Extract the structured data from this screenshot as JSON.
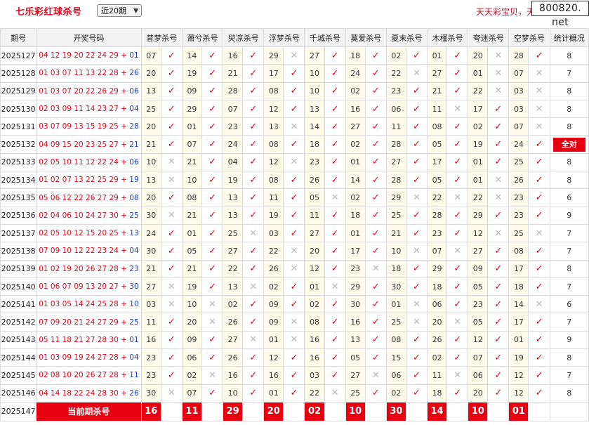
{
  "header": {
    "title": "七乐彩红球杀号",
    "period_select": "近20期",
    "slogan": "天天彩宝贝，天",
    "logo_text": "800820. net"
  },
  "table": {
    "columns": [
      "期号",
      "开奖号码",
      "昔梦杀号",
      "萧兮杀号",
      "臾凉杀号",
      "浮梦杀号",
      "千城杀号",
      "莫爱杀号",
      "夏末杀号",
      "木槿杀号",
      "夸迷杀号",
      "空梦杀号",
      "统计概况"
    ],
    "rows": [
      {
        "issue": "2025127",
        "reds": "04 12 19 20 22 24 29 +",
        "blue": "01",
        "kills": [
          {
            "n": "07",
            "m": "✓"
          },
          {
            "n": "14",
            "m": "✓"
          },
          {
            "n": "16",
            "m": "✓"
          },
          {
            "n": "29",
            "m": "✕"
          },
          {
            "n": "27",
            "m": "✓"
          },
          {
            "n": "18",
            "m": "✓"
          },
          {
            "n": "02",
            "m": "✓"
          },
          {
            "n": "01",
            "m": "✓"
          },
          {
            "n": "20",
            "m": "✕"
          },
          {
            "n": "28",
            "m": "✓"
          }
        ],
        "total": "8"
      },
      {
        "issue": "2025128",
        "reds": "01 03 07 11 13 22 28 +",
        "blue": "26",
        "kills": [
          {
            "n": "20",
            "m": "✓"
          },
          {
            "n": "19",
            "m": "✓"
          },
          {
            "n": "21",
            "m": "✓"
          },
          {
            "n": "17",
            "m": "✓"
          },
          {
            "n": "10",
            "m": "✓"
          },
          {
            "n": "24",
            "m": "✓"
          },
          {
            "n": "22",
            "m": "✕"
          },
          {
            "n": "27",
            "m": "✓"
          },
          {
            "n": "01",
            "m": "✕"
          },
          {
            "n": "07",
            "m": "✕"
          }
        ],
        "total": "7"
      },
      {
        "issue": "2025129",
        "reds": "01 03 07 20 22 26 29 +",
        "blue": "06",
        "kills": [
          {
            "n": "13",
            "m": "✓"
          },
          {
            "n": "09",
            "m": "✓"
          },
          {
            "n": "28",
            "m": "✓"
          },
          {
            "n": "08",
            "m": "✓"
          },
          {
            "n": "10",
            "m": "✓"
          },
          {
            "n": "02",
            "m": "✓"
          },
          {
            "n": "23",
            "m": "✓"
          },
          {
            "n": "21",
            "m": "✓"
          },
          {
            "n": "22",
            "m": "✕"
          },
          {
            "n": "03",
            "m": "✕"
          }
        ],
        "total": "8"
      },
      {
        "issue": "2025130",
        "reds": "02 03 09 11 14 23 27 +",
        "blue": "04",
        "kills": [
          {
            "n": "25",
            "m": "✓"
          },
          {
            "n": "29",
            "m": "✓"
          },
          {
            "n": "07",
            "m": "✓"
          },
          {
            "n": "12",
            "m": "✓"
          },
          {
            "n": "13",
            "m": "✓"
          },
          {
            "n": "16",
            "m": "✓"
          },
          {
            "n": "06",
            "m": "✓"
          },
          {
            "n": "11",
            "m": "✕"
          },
          {
            "n": "17",
            "m": "✓"
          },
          {
            "n": "03",
            "m": "✕"
          }
        ],
        "total": "8"
      },
      {
        "issue": "2025131",
        "reds": "03 07 09 13 15 19 25 +",
        "blue": "28",
        "kills": [
          {
            "n": "20",
            "m": "✓"
          },
          {
            "n": "01",
            "m": "✓"
          },
          {
            "n": "23",
            "m": "✓"
          },
          {
            "n": "13",
            "m": "✕"
          },
          {
            "n": "14",
            "m": "✓"
          },
          {
            "n": "27",
            "m": "✓"
          },
          {
            "n": "11",
            "m": "✓"
          },
          {
            "n": "08",
            "m": "✓"
          },
          {
            "n": "02",
            "m": "✓"
          },
          {
            "n": "07",
            "m": "✕"
          }
        ],
        "total": "8"
      },
      {
        "issue": "2025132",
        "reds": "04 09 15 20 23 25 27 +",
        "blue": "21",
        "kills": [
          {
            "n": "21",
            "m": "✓"
          },
          {
            "n": "07",
            "m": "✓"
          },
          {
            "n": "24",
            "m": "✓"
          },
          {
            "n": "08",
            "m": "✓"
          },
          {
            "n": "18",
            "m": "✓"
          },
          {
            "n": "02",
            "m": "✓"
          },
          {
            "n": "28",
            "m": "✓"
          },
          {
            "n": "05",
            "m": "✓"
          },
          {
            "n": "19",
            "m": "✓"
          },
          {
            "n": "24",
            "m": "✓"
          }
        ],
        "total": "全对",
        "allhit": true
      },
      {
        "issue": "2025133",
        "reds": "02 05 10 11 12 22 24 +",
        "blue": "06",
        "kills": [
          {
            "n": "10",
            "m": "✕"
          },
          {
            "n": "21",
            "m": "✓"
          },
          {
            "n": "04",
            "m": "✓"
          },
          {
            "n": "12",
            "m": "✕"
          },
          {
            "n": "23",
            "m": "✓"
          },
          {
            "n": "01",
            "m": "✓"
          },
          {
            "n": "27",
            "m": "✓"
          },
          {
            "n": "17",
            "m": "✓"
          },
          {
            "n": "01",
            "m": "✓"
          },
          {
            "n": "25",
            "m": "✓"
          }
        ],
        "total": "8"
      },
      {
        "issue": "2025134",
        "reds": "01 02 07 13 22 25 29 +",
        "blue": "19",
        "kills": [
          {
            "n": "13",
            "m": "✕"
          },
          {
            "n": "10",
            "m": "✓"
          },
          {
            "n": "19",
            "m": "✓"
          },
          {
            "n": "08",
            "m": "✓"
          },
          {
            "n": "26",
            "m": "✓"
          },
          {
            "n": "14",
            "m": "✓"
          },
          {
            "n": "28",
            "m": "✓"
          },
          {
            "n": "05",
            "m": "✓"
          },
          {
            "n": "01",
            "m": "✕"
          },
          {
            "n": "26",
            "m": "✓"
          }
        ],
        "total": "8"
      },
      {
        "issue": "2025135",
        "reds": "05 06 12 22 26 27 29 +",
        "blue": "08",
        "kills": [
          {
            "n": "20",
            "m": "✓"
          },
          {
            "n": "08",
            "m": "✓"
          },
          {
            "n": "13",
            "m": "✓"
          },
          {
            "n": "11",
            "m": "✓"
          },
          {
            "n": "05",
            "m": "✕"
          },
          {
            "n": "02",
            "m": "✓"
          },
          {
            "n": "29",
            "m": "✕"
          },
          {
            "n": "22",
            "m": "✕"
          },
          {
            "n": "22",
            "m": "✕"
          },
          {
            "n": "23",
            "m": "✓"
          }
        ],
        "total": "6"
      },
      {
        "issue": "2025136",
        "reds": "02 04 06 10 24 27 30 +",
        "blue": "25",
        "kills": [
          {
            "n": "30",
            "m": "✕"
          },
          {
            "n": "21",
            "m": "✓"
          },
          {
            "n": "13",
            "m": "✓"
          },
          {
            "n": "19",
            "m": "✓"
          },
          {
            "n": "11",
            "m": "✓"
          },
          {
            "n": "18",
            "m": "✓"
          },
          {
            "n": "25",
            "m": "✓"
          },
          {
            "n": "28",
            "m": "✓"
          },
          {
            "n": "29",
            "m": "✓"
          },
          {
            "n": "23",
            "m": "✓"
          }
        ],
        "total": "9"
      },
      {
        "issue": "2025137",
        "reds": "02 05 10 12 15 20 25 +",
        "blue": "13",
        "kills": [
          {
            "n": "24",
            "m": "✓"
          },
          {
            "n": "01",
            "m": "✓"
          },
          {
            "n": "25",
            "m": "✕"
          },
          {
            "n": "03",
            "m": "✓"
          },
          {
            "n": "27",
            "m": "✓"
          },
          {
            "n": "01",
            "m": "✓"
          },
          {
            "n": "21",
            "m": "✓"
          },
          {
            "n": "23",
            "m": "✓"
          },
          {
            "n": "12",
            "m": "✕"
          },
          {
            "n": "25",
            "m": "✕"
          }
        ],
        "total": "7"
      },
      {
        "issue": "2025138",
        "reds": "07 09 10 12 22 23 24 +",
        "blue": "04",
        "kills": [
          {
            "n": "30",
            "m": "✓"
          },
          {
            "n": "05",
            "m": "✓"
          },
          {
            "n": "27",
            "m": "✓"
          },
          {
            "n": "22",
            "m": "✕"
          },
          {
            "n": "20",
            "m": "✓"
          },
          {
            "n": "17",
            "m": "✓"
          },
          {
            "n": "10",
            "m": "✕"
          },
          {
            "n": "07",
            "m": "✕"
          },
          {
            "n": "27",
            "m": "✓"
          },
          {
            "n": "08",
            "m": "✓"
          }
        ],
        "total": "7"
      },
      {
        "issue": "2025139",
        "reds": "01 02 19 20 26 27 28 +",
        "blue": "23",
        "kills": [
          {
            "n": "21",
            "m": "✓"
          },
          {
            "n": "21",
            "m": "✓"
          },
          {
            "n": "22",
            "m": "✓"
          },
          {
            "n": "26",
            "m": "✕"
          },
          {
            "n": "12",
            "m": "✓"
          },
          {
            "n": "23",
            "m": "✕"
          },
          {
            "n": "18",
            "m": "✓"
          },
          {
            "n": "29",
            "m": "✓"
          },
          {
            "n": "09",
            "m": "✓"
          },
          {
            "n": "17",
            "m": "✓"
          }
        ],
        "total": "8"
      },
      {
        "issue": "2025140",
        "reds": "01 06 07 09 13 20 27 +",
        "blue": "30",
        "kills": [
          {
            "n": "27",
            "m": "✕"
          },
          {
            "n": "19",
            "m": "✓"
          },
          {
            "n": "13",
            "m": "✕"
          },
          {
            "n": "02",
            "m": "✓"
          },
          {
            "n": "01",
            "m": "✕"
          },
          {
            "n": "29",
            "m": "✓"
          },
          {
            "n": "30",
            "m": "✓"
          },
          {
            "n": "18",
            "m": "✓"
          },
          {
            "n": "05",
            "m": "✓"
          },
          {
            "n": "18",
            "m": "✓"
          }
        ],
        "total": "7"
      },
      {
        "issue": "2025141",
        "reds": "01 03 05 14 24 25 28 +",
        "blue": "10",
        "kills": [
          {
            "n": "03",
            "m": "✕"
          },
          {
            "n": "10",
            "m": "✕"
          },
          {
            "n": "02",
            "m": "✓"
          },
          {
            "n": "09",
            "m": "✓"
          },
          {
            "n": "02",
            "m": "✓"
          },
          {
            "n": "30",
            "m": "✓"
          },
          {
            "n": "01",
            "m": "✕"
          },
          {
            "n": "06",
            "m": "✓"
          },
          {
            "n": "23",
            "m": "✓"
          },
          {
            "n": "14",
            "m": "✕"
          }
        ],
        "total": "6"
      },
      {
        "issue": "2025142",
        "reds": "07 09 20 21 24 27 29 +",
        "blue": "25",
        "kills": [
          {
            "n": "11",
            "m": "✓"
          },
          {
            "n": "20",
            "m": "✕"
          },
          {
            "n": "26",
            "m": "✓"
          },
          {
            "n": "09",
            "m": "✕"
          },
          {
            "n": "08",
            "m": "✓"
          },
          {
            "n": "16",
            "m": "✓"
          },
          {
            "n": "25",
            "m": "✕"
          },
          {
            "n": "20",
            "m": "✕"
          },
          {
            "n": "05",
            "m": "✓"
          },
          {
            "n": "17",
            "m": "✓"
          }
        ],
        "total": "7"
      },
      {
        "issue": "2025143",
        "reds": "05 11 18 21 27 28 30 +",
        "blue": "01",
        "kills": [
          {
            "n": "16",
            "m": "✓"
          },
          {
            "n": "09",
            "m": "✓"
          },
          {
            "n": "27",
            "m": "✕"
          },
          {
            "n": "01",
            "m": "✕"
          },
          {
            "n": "16",
            "m": "✓"
          },
          {
            "n": "13",
            "m": "✓"
          },
          {
            "n": "08",
            "m": "✓"
          },
          {
            "n": "26",
            "m": "✓"
          },
          {
            "n": "12",
            "m": "✓"
          },
          {
            "n": "01",
            "m": "✓"
          }
        ],
        "total": "9"
      },
      {
        "issue": "2025144",
        "reds": "01 03 09 19 24 27 28 +",
        "blue": "04",
        "kills": [
          {
            "n": "23",
            "m": "✓"
          },
          {
            "n": "06",
            "m": "✓"
          },
          {
            "n": "26",
            "m": "✓"
          },
          {
            "n": "12",
            "m": "✓"
          },
          {
            "n": "16",
            "m": "✓"
          },
          {
            "n": "05",
            "m": "✓"
          },
          {
            "n": "15",
            "m": "✓"
          },
          {
            "n": "02",
            "m": "✓"
          },
          {
            "n": "07",
            "m": "✓"
          },
          {
            "n": "19",
            "m": "✓"
          }
        ],
        "total": "8"
      },
      {
        "issue": "2025145",
        "reds": "02 08 10 20 26 27 28 +",
        "blue": "11",
        "kills": [
          {
            "n": "23",
            "m": "✓"
          },
          {
            "n": "02",
            "m": "✕"
          },
          {
            "n": "16",
            "m": "✓"
          },
          {
            "n": "16",
            "m": "✓"
          },
          {
            "n": "03",
            "m": "✓"
          },
          {
            "n": "27",
            "m": "✕"
          },
          {
            "n": "06",
            "m": "✓"
          },
          {
            "n": "11",
            "m": "✕"
          },
          {
            "n": "06",
            "m": "✓"
          },
          {
            "n": "12",
            "m": "✓"
          }
        ],
        "total": "7"
      },
      {
        "issue": "2025146",
        "reds": "04 14 18 22 24 28 30 +",
        "blue": "26",
        "kills": [
          {
            "n": "30",
            "m": "✕"
          },
          {
            "n": "07",
            "m": "✓"
          },
          {
            "n": "10",
            "m": "✓"
          },
          {
            "n": "01",
            "m": "✓"
          },
          {
            "n": "22",
            "m": "✕"
          },
          {
            "n": "25",
            "m": "✓"
          },
          {
            "n": "02",
            "m": "✓"
          },
          {
            "n": "18",
            "m": "✓"
          },
          {
            "n": "20",
            "m": "✓"
          },
          {
            "n": "12",
            "m": "✓"
          }
        ],
        "total": "8"
      }
    ],
    "current": {
      "issue": "2025147",
      "label": "当前期杀号",
      "kills": [
        "16",
        "11",
        "29",
        "20",
        "02",
        "10",
        "30",
        "14",
        "10",
        "01"
      ]
    }
  },
  "colors": {
    "title_red": "#e0061a",
    "highlight_red": "#e60012",
    "blue_ball": "#1a3fc8",
    "kill_cell_bg": "#fffbea",
    "check_red": "#e0061a",
    "cross_gray": "#b9b9b9"
  },
  "icons": {
    "hit": "check-mark-icon",
    "miss": "cross-mark-icon",
    "dropdown": "chevron-down-icon"
  }
}
